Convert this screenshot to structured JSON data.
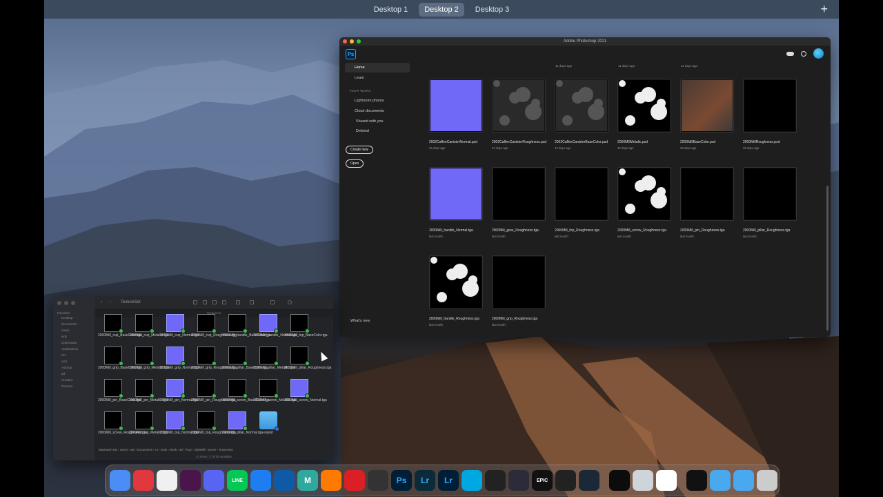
{
  "spaces": {
    "items": [
      "Desktop 1",
      "Desktop 2",
      "Desktop 3"
    ],
    "active": 1
  },
  "photoshop": {
    "window_title": "Adobe Photoshop 2021",
    "logo": "Ps",
    "nav": {
      "home": "Home",
      "learn": "Learn",
      "section": "YOUR WORK",
      "lightroom": "Lightroom photos",
      "cloud_docs": "Cloud documents",
      "shared": "Shared with you",
      "deleted": "Deleted"
    },
    "create_new": "Create new",
    "open": "Open",
    "whats_new": "What's new",
    "top_stamps": [
      "11 days ago",
      "11 days ago",
      "11 days ago"
    ],
    "files": [
      {
        "name": "2002CaffeeCanisterNormal.psd",
        "date": "24 days ago",
        "tile": "blue"
      },
      {
        "name": "2002CaffeeCanisterRoughness.psd",
        "date": "24 days ago",
        "tile": "gray"
      },
      {
        "name": "2002CaffeeCanisterBaseColor.psd",
        "date": "24 days ago",
        "tile": "gray"
      },
      {
        "name": "2000MillMetalic.psd",
        "date": "25 days ago",
        "tile": "black"
      },
      {
        "name": "2000MillBaseColor.psd",
        "date": "25 days ago",
        "tile": "brown"
      },
      {
        "name": "2000MillRoughness.psd",
        "date": "25 days ago",
        "tile": "black"
      },
      {
        "name": "2000Mill_handle_Normal.tga",
        "date": "last month",
        "tile": "blue"
      },
      {
        "name": "2000Mill_gear_Roughness.tga",
        "date": "last month",
        "tile": "black"
      },
      {
        "name": "2000Mill_top_Roughness.tga",
        "date": "last month",
        "tile": "black"
      },
      {
        "name": "2000Mill_screw_Roughness.tga",
        "date": "last month",
        "tile": "black"
      },
      {
        "name": "2000Mill_pin_Roughness.tga",
        "date": "last month",
        "tile": "black"
      },
      {
        "name": "2000Mill_pillar_Roughness.tga",
        "date": "last month",
        "tile": "black"
      },
      {
        "name": "2000Mill_handle_Roughness.tga",
        "date": "last month",
        "tile": "black"
      },
      {
        "name": "2000Mill_grip_Roughness.tga",
        "date": "last month",
        "tile": "black"
      }
    ]
  },
  "finder": {
    "title": "TextureSet",
    "tab_label": "Textureset",
    "favorites_label": "Favorites",
    "sidebar": [
      "Desktop",
      "Documents",
      "music",
      "vids",
      "Downloads",
      "Applications",
      "zzz",
      "owri",
      "AirDrop",
      "3d",
      "Creative",
      "Pictures"
    ],
    "files": [
      {
        "name": "2000Mill_cup_BaseColor.tga",
        "kind": "black"
      },
      {
        "name": "2000Mill_cup_Metallic.tga",
        "kind": "black"
      },
      {
        "name": "2000Mill_cup_Normal.tga",
        "kind": "blue"
      },
      {
        "name": "2000Mill_cup_Roughness.tga",
        "kind": "black"
      },
      {
        "name": "2000Mill_handle_BaseColor.tga",
        "kind": "black"
      },
      {
        "name": "2000Mill_handle_Normal.tga",
        "kind": "blue"
      },
      {
        "name": "2000Mill_top_BaseColor.tga",
        "kind": "black"
      },
      {
        "name": "2000Mill_grip_BaseColor.tga",
        "kind": "black"
      },
      {
        "name": "2000Mill_grip_Metallic.tga",
        "kind": "black"
      },
      {
        "name": "2000Mill_grip_Normal.tga",
        "kind": "blue"
      },
      {
        "name": "2000Mill_grip_Roughness.tga",
        "kind": "black"
      },
      {
        "name": "2000Mill_pillar_BaseColor.tga",
        "kind": "black"
      },
      {
        "name": "2000Mill_pillar_Metallic.tga",
        "kind": "black"
      },
      {
        "name": "2000Mill_pillar_Roughness.tga",
        "kind": "black"
      },
      {
        "name": "2000Mill_pin_BaseColor.tga",
        "kind": "black"
      },
      {
        "name": "2000Mill_pin_Metallic.tga",
        "kind": "black"
      },
      {
        "name": "2000Mill_pin_Normal.tga",
        "kind": "blue"
      },
      {
        "name": "2000Mill_pin_Roughness.tga",
        "kind": "black"
      },
      {
        "name": "2000Mill_screw_BaseColor.tga",
        "kind": "black"
      },
      {
        "name": "2000Mill_screw_Metallic.tga",
        "kind": "black"
      },
      {
        "name": "2000Mill_screw_Normal.tga",
        "kind": "blue"
      },
      {
        "name": "2000Mill_screw_Roughness.tga",
        "kind": "black"
      },
      {
        "name": "2000Mill_top_Metallic.tga",
        "kind": "black"
      },
      {
        "name": "2000Mill_top_Normal.tga",
        "kind": "blue"
      },
      {
        "name": "2000Mill_top_Roughness.tga",
        "kind": "black"
      },
      {
        "name": "2000Mill_pillar_Normal.tga",
        "kind": "blue"
      },
      {
        "name": "export",
        "kind": "folder"
      }
    ],
    "path": "Macintosh HD › Users › wei › Documents › cs › trunk › Work › 3d › Prop › 2000Mill › Scene › TextureSet",
    "status": "41 items, 1.75 TB available"
  },
  "dock": [
    "Finder",
    "Vivaldi",
    "Arc",
    "Slack",
    "Discord",
    "LINE",
    "Maps",
    "VS Code",
    "Maya",
    "Houdini",
    "Creative Cloud",
    "Script Editor",
    "Ps",
    "Lr Classic",
    "Lr",
    "Amazon Photos",
    "Substance",
    "DaVinci Resolve",
    "Epic Games",
    "Unity",
    "Steam",
    "Activity Monitor",
    "Disk Utility",
    "Preview",
    "Warning Console",
    "Applications",
    "Downloads",
    "Trash"
  ],
  "dock_labels": {
    "Ps": "Ps",
    "Lr Classic": "Lr",
    "Lr": "Lr",
    "LINE": "LINE",
    "Maya": "M",
    "Epic Games": "EPIC"
  }
}
